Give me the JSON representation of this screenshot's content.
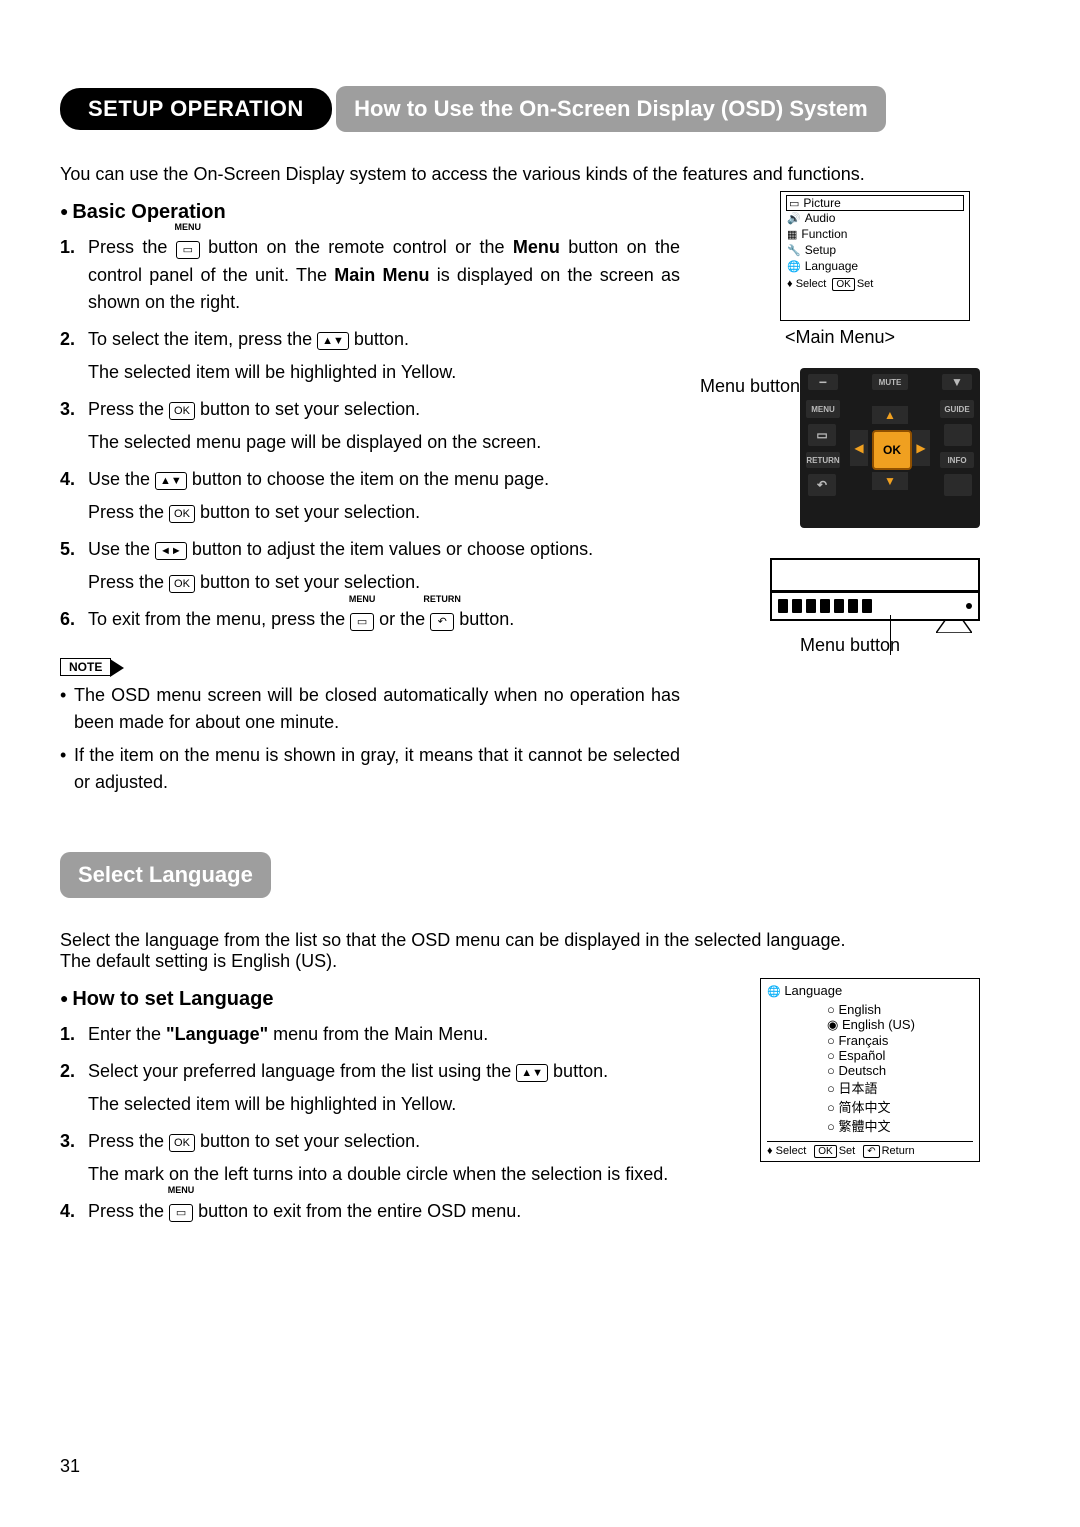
{
  "chapter": "SETUP OPERATION",
  "section1": {
    "title": "How to Use the On-Screen Display (OSD) System",
    "intro": "You can use the On-Screen Display system to access the various kinds of the features and functions.",
    "subhead": "Basic Operation",
    "steps": {
      "s1a": "Press the ",
      "s1b": " button on the remote control or the ",
      "s1c": "Menu",
      "s1d": " button on the control panel of the unit. The ",
      "s1e": "Main Menu",
      "s1f": " is displayed on the screen as shown on the right.",
      "s2a": "To select the item, press the ",
      "s2b": " button.",
      "s2c": "The selected item will be highlighted in Yellow.",
      "s3a": "Press the ",
      "s3b": " button to set your selection.",
      "s3c": "The selected menu page will be displayed on the screen.",
      "s4a": "Use the ",
      "s4b": " button to choose the item on the menu page.",
      "s4c": "Press the ",
      "s4d": " button to set your selection.",
      "s5a": "Use the ",
      "s5b": " button to adjust the item values or choose options.",
      "s5c": "Press the ",
      "s5d": " button to set your selection.",
      "s6a": "To exit from the menu, press the ",
      "s6b": " or the ",
      "s6c": " button."
    },
    "icon_labels": {
      "menu": "MENU",
      "return": "RETURN"
    },
    "note_label": "NOTE",
    "notes": {
      "n1": "The OSD menu screen will be closed automatically when no operation has been made for about one minute.",
      "n2": "If the item on the menu is shown in gray, it means that it cannot be selected or adjusted."
    }
  },
  "main_menu": {
    "items": [
      "Picture",
      "Audio",
      "Function",
      "Setup",
      "Language"
    ],
    "footer_select": "Select",
    "footer_set": "Set",
    "caption": "<Main Menu>",
    "label_side": "Menu button"
  },
  "remote": {
    "mute": "MUTE",
    "menu": "MENU",
    "guide": "GUIDE",
    "return": "RETURN",
    "info": "INFO",
    "ok": "OK"
  },
  "tv_caption": "Menu button",
  "section2": {
    "title": "Select Language",
    "intro1": "Select the language from the list so that the OSD menu can be displayed in the selected language.",
    "intro2": "The default setting is English (US).",
    "subhead": "How to set Language",
    "steps": {
      "s1a": "Enter the ",
      "s1b": "\"Language\"",
      "s1c": " menu from the Main Menu.",
      "s2a": "Select your preferred language from the list using the ",
      "s2b": " button.",
      "s2c": "The selected item will be highlighted in Yellow.",
      "s3a": "Press the ",
      "s3b": " button to set your selection.",
      "s3c": "The mark on the left turns into a double circle when the selection is fixed.",
      "s4a": "Press the ",
      "s4b": " button to exit from the entire OSD menu."
    }
  },
  "lang_box": {
    "header": "Language",
    "items": [
      "English",
      "English (US)",
      "Français",
      "Español",
      "Deutsch",
      "日本語",
      "简体中文",
      "繁體中文"
    ],
    "selected_index": 1,
    "footer": {
      "select": "Select",
      "set": "Set",
      "return": "Return"
    }
  },
  "keys": {
    "ok": "OK",
    "updown": "▲▼",
    "leftright": "◄►",
    "menu": "▭",
    "return": "↶"
  },
  "page_number": "31"
}
